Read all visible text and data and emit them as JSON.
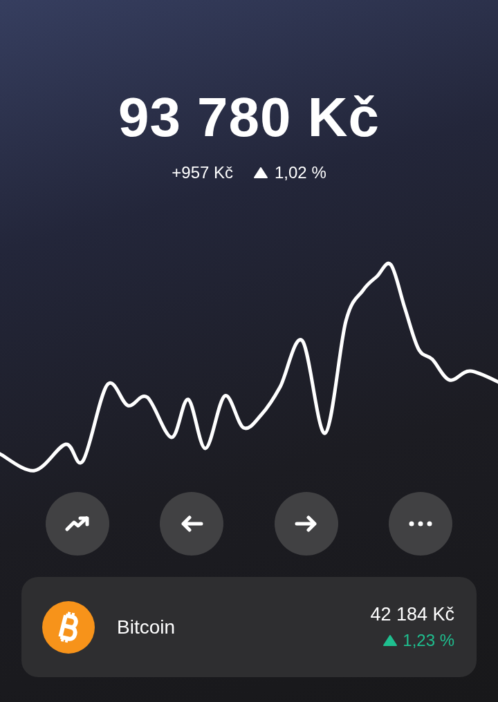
{
  "balance": {
    "amount": "93 780 Kč",
    "change_abs": "+957 Kč",
    "change_pct": "1,02 %",
    "rising": true
  },
  "chart": {
    "kind": "sparkline"
  },
  "actions": [
    {
      "kind": "trend"
    },
    {
      "kind": "send"
    },
    {
      "kind": "receive"
    },
    {
      "kind": "more"
    }
  ],
  "assets": [
    {
      "name": "Bitcoin",
      "value": "42 184 Kč",
      "change_pct": "1,23 %",
      "rising": true,
      "color": "#1fbf8f"
    }
  ]
}
